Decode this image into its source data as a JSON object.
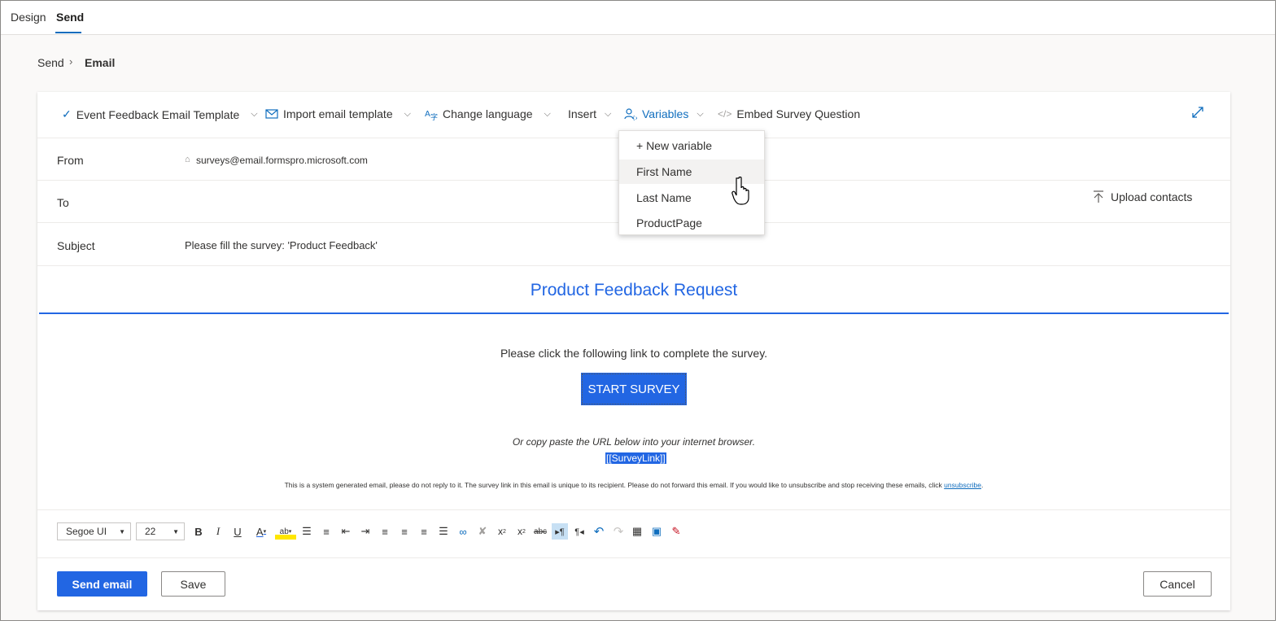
{
  "tabs": [
    {
      "label": "Design"
    },
    {
      "label": "Send"
    }
  ],
  "breadcrumb": {
    "parent": "Send",
    "current": "Email"
  },
  "toolbar": {
    "template": "Event Feedback Email Template",
    "import": "Import email template",
    "language": "Change language",
    "insert": "Insert",
    "variables": "Variables",
    "embed": "Embed Survey Question"
  },
  "fields": {
    "from_label": "From",
    "from_value": "surveys@email.formspro.microsoft.com",
    "to_label": "To",
    "upload": "Upload contacts",
    "subject_label": "Subject",
    "subject_value": "Please fill the survey: 'Product Feedback'"
  },
  "email": {
    "title": "Product Feedback Request",
    "instruction": "Please click the following link to complete the survey.",
    "button": "START SURVEY",
    "copy_text": "Or copy paste the URL below into your internet browser.",
    "link": "[[SurveyLink]]",
    "disclaimer": "This is a system generated email, please do not reply to it. The survey link in this email is unique to its recipient. Please do not forward this email. If you would like to unsubscribe and stop receiving these emails, click ",
    "unsubscribe": "unsubscribe",
    "disclaimer_end": "."
  },
  "format": {
    "font": "Segoe UI",
    "size": "22"
  },
  "actions": {
    "send": "Send email",
    "save": "Save",
    "cancel": "Cancel"
  },
  "variables_menu": [
    "+ New variable",
    "First Name",
    "Last Name",
    "ProductPage"
  ],
  "colors": {
    "accent": "#2266e3",
    "link": "#0f6cbd"
  }
}
